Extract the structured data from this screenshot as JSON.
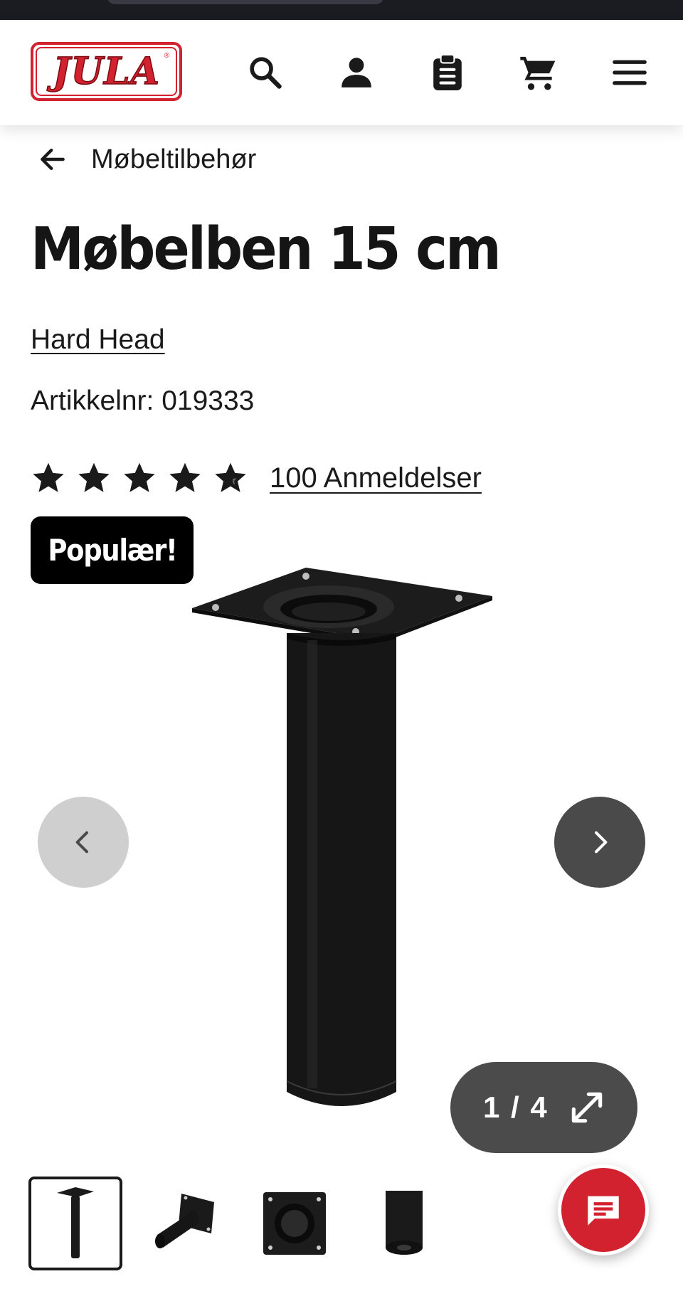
{
  "header": {
    "logo_text": "JULA",
    "logo_mark": "®",
    "icons": [
      "search-icon",
      "account-icon",
      "clipboard-icon",
      "cart-icon",
      "menu-icon"
    ]
  },
  "breadcrumb": {
    "label": "Møbeltilbehør"
  },
  "product": {
    "title": "Møbelben 15 cm",
    "brand": "Hard Head",
    "article_number": "Artikkelnr: 019333",
    "rating": {
      "stars_filled": 4.5,
      "stars_total": 5
    },
    "reviews_label": "100 Anmeldelser",
    "badge": "Populær!"
  },
  "gallery": {
    "counter": "1 / 4",
    "current_index": 1,
    "total": 4,
    "thumbnails": [
      "leg-front-view",
      "leg-angled-view",
      "mounting-plate-top-view",
      "leg-foot-detail"
    ]
  },
  "colors": {
    "brand_red": "#d2222f",
    "badge_black": "#000000",
    "nav_dark": "#4a4a4a",
    "nav_light": "#cfcfcf"
  }
}
